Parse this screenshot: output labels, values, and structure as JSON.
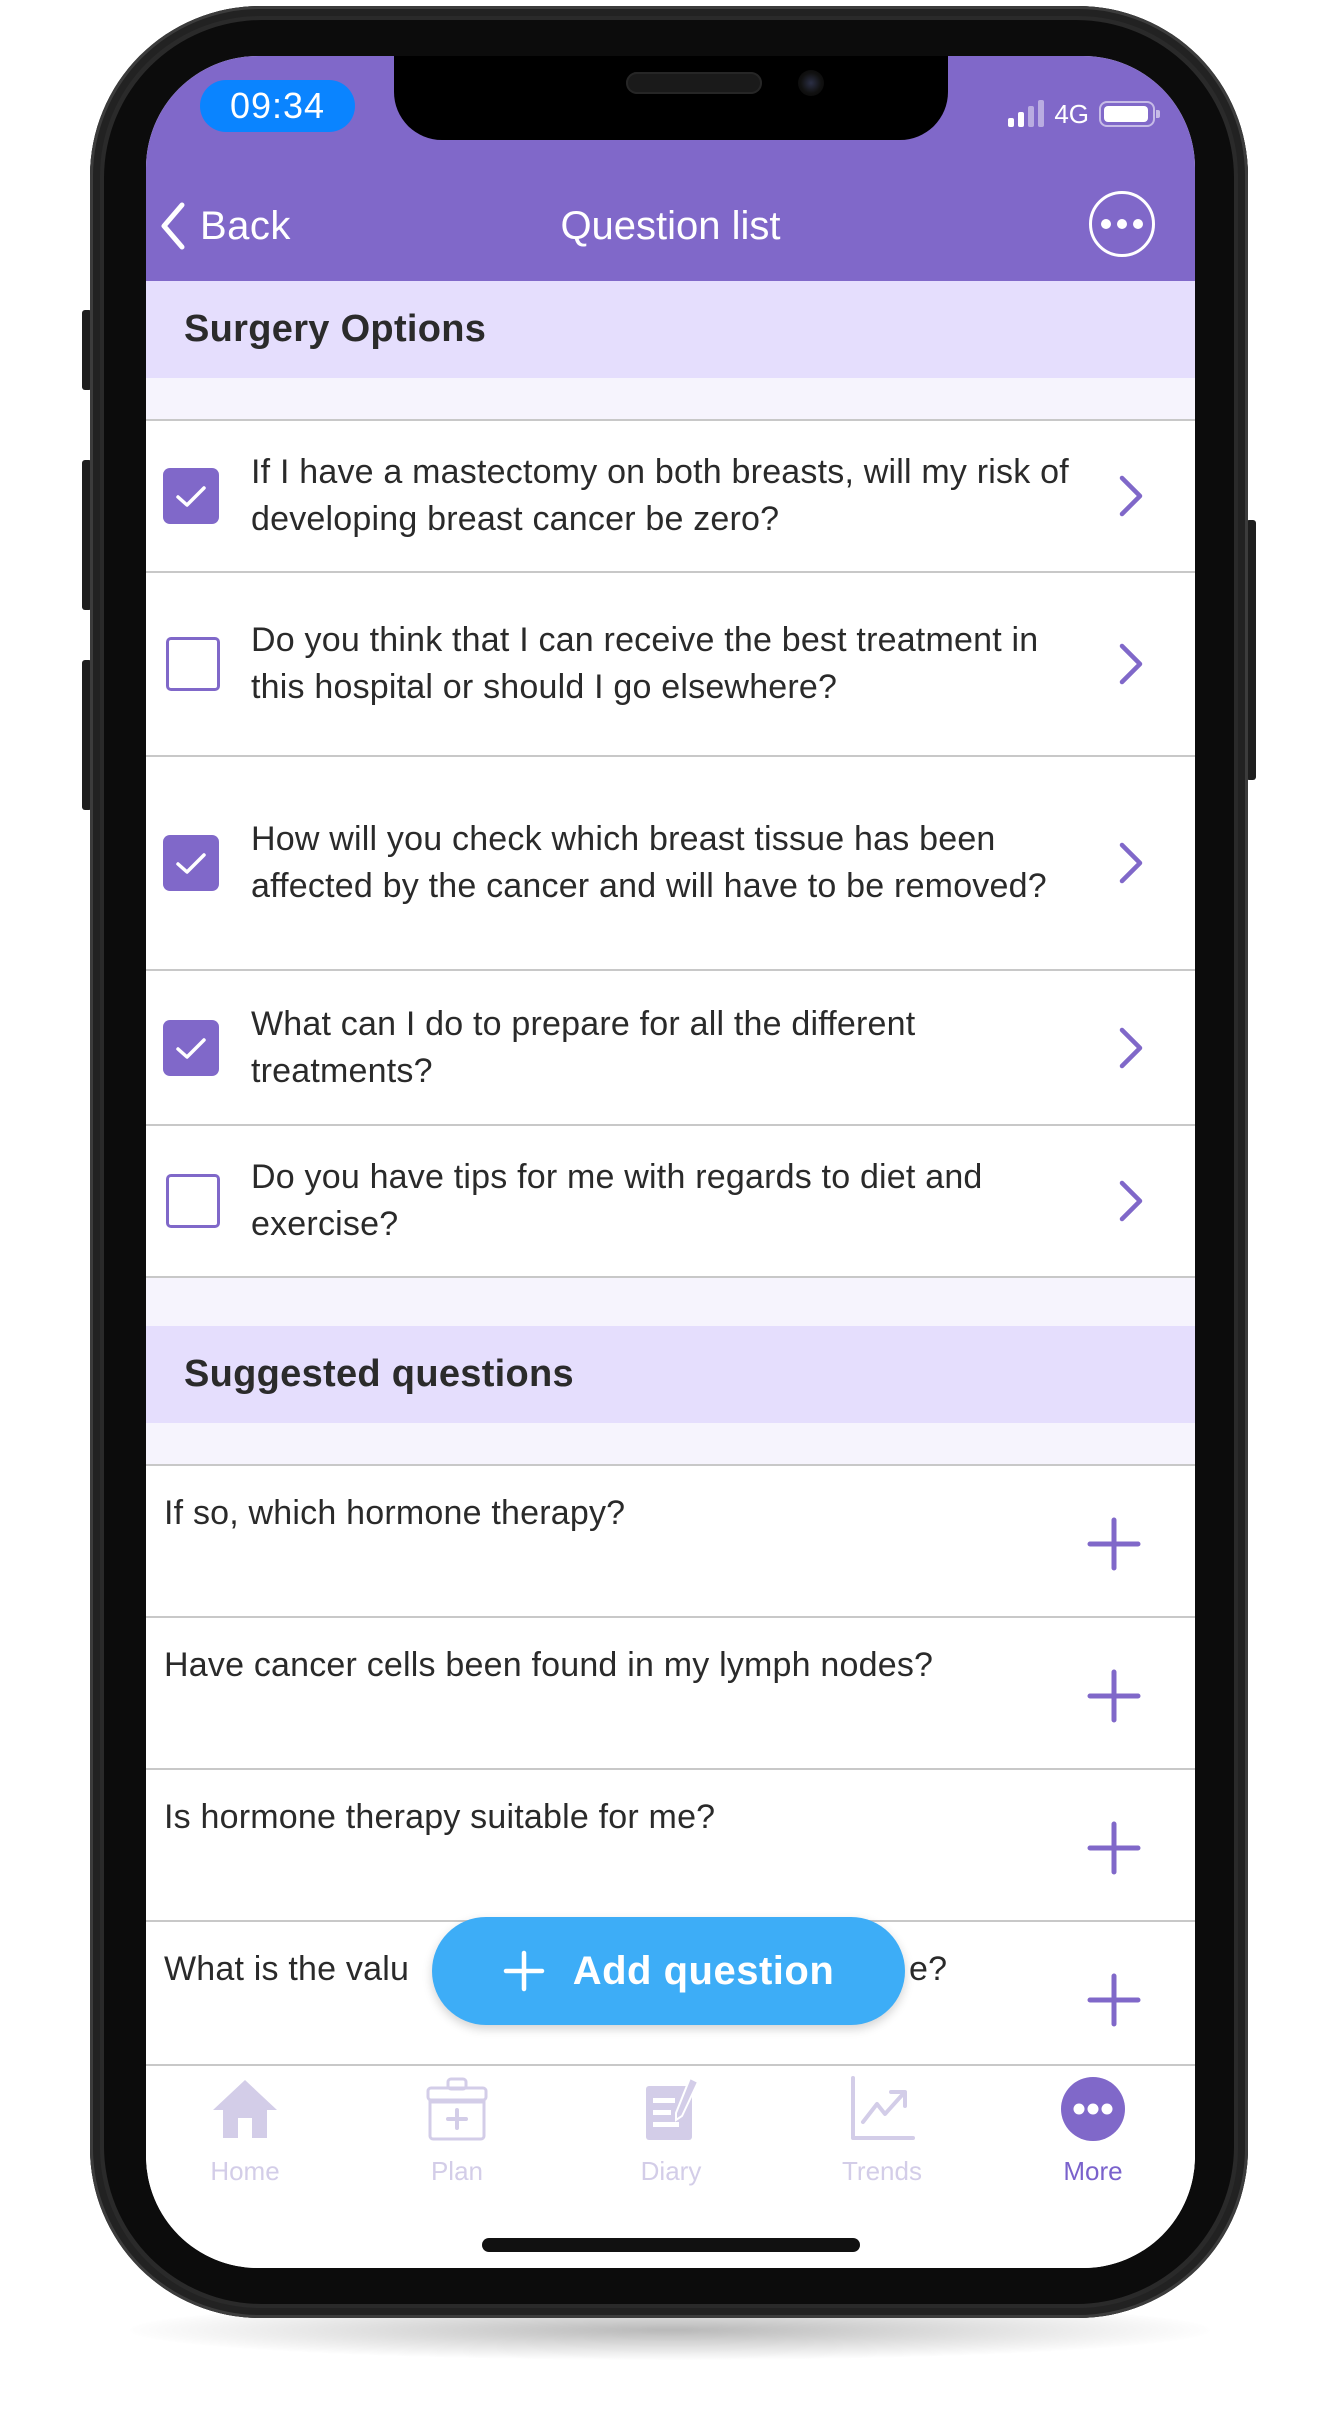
{
  "status_bar": {
    "time": "09:34",
    "network": "4G",
    "signal_bars_active": 2,
    "signal_bars_total": 4,
    "battery_level": 0.95
  },
  "nav": {
    "back_label": "Back",
    "back_icon": "chevron-left-icon",
    "title": "Question list",
    "more_icon": "more-circle-icon"
  },
  "sections": [
    {
      "title": "Surgery Options",
      "items": [
        {
          "text": "If I have a mastectomy on both breasts, will my risk of developing breast cancer be zero?",
          "checked": true
        },
        {
          "text": "Do you think that I can receive the best treatment in this hospital or should I go elsewhere?",
          "checked": false
        },
        {
          "text": "How will you check which breast tissue has been affected by the cancer and will have to be removed?",
          "checked": true
        },
        {
          "text": "What can I do to prepare for all the different treatments?",
          "checked": true
        },
        {
          "text": "Do you have tips for me with regards to diet and exercise?",
          "checked": false
        }
      ]
    },
    {
      "title": "Suggested questions",
      "items": [
        {
          "text": "If so, which hormone therapy?"
        },
        {
          "text": "Have cancer cells been found in my lymph nodes?"
        },
        {
          "text": "Is hormone therapy suitable for me?"
        },
        {
          "text": "What is the valu",
          "text_tail": "e?"
        }
      ]
    }
  ],
  "fab": {
    "label": "Add question",
    "icon": "plus-icon"
  },
  "tabbar": {
    "active": "More",
    "tabs": [
      {
        "label": "Home",
        "icon": "home-icon"
      },
      {
        "label": "Plan",
        "icon": "calendar-plus-icon"
      },
      {
        "label": "Diary",
        "icon": "diary-edit-icon"
      },
      {
        "label": "Trends",
        "icon": "trend-chart-icon"
      },
      {
        "label": "More",
        "icon": "more-dots-icon"
      }
    ]
  },
  "colors": {
    "accent": "#8068c9",
    "section_band": "#e5defd",
    "fab": "#3dadf7",
    "time_pill": "#0a84ff",
    "tab_inactive": "#d3cde8",
    "tab_active": "#7a62cc"
  }
}
